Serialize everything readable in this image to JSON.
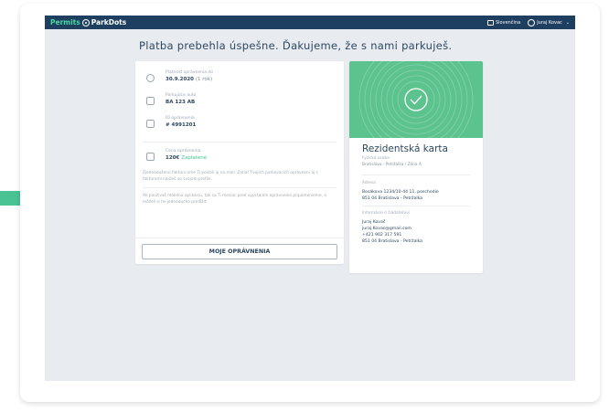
{
  "colors": {
    "accent": "#49c394",
    "topbar": "#1f3f60",
    "card_header": "#5cc28e",
    "arrow": "#49c394"
  },
  "topbar": {
    "brand_permits": "Permits",
    "brand_parkdots": "ParkDots",
    "language": "Slovenčina",
    "user": "Juraj Kovac"
  },
  "headline": "Platba prebehla úspešne. Ďakujeme, že s nami parkuješ.",
  "permit": {
    "validity_label": "Platnosť oprávnenia do",
    "validity_value": "30.9.2020",
    "validity_extra": "(1 rok)",
    "car_label": "Parkujúce auto",
    "car_value": "BA 123 AB",
    "id_label": "ID oprávnenia",
    "id_value": "# 4991201",
    "price_label": "Cena oprávnenia",
    "price_value": "120€",
    "price_status": "Zaplatené",
    "note_invoice": "Zjednodušenú faktúru sme Ti poslali aj na mail. Zatiaľ Tvojich parkovacích oprávnení aj s faktúrami nájdeš vo svojom profile.",
    "note_reminder": "Ak používaš mobilnú aplikáciu, tak sa Ti mesiac pred vypršaním oprávnenia pripomenieme, a môžeš si ho jednoducho predĺžiť.",
    "button": "MOJE OPRÁVNENIA"
  },
  "card": {
    "title": "Rezidentská karta",
    "zone_label": "Fyzická osoba",
    "zone_value": "Bratislava - Petržalka / Zóna A",
    "address_label": "Adresa",
    "address_line1": "Bosákova 1234/10-44 11. poschodie",
    "address_line2": "851 04 Bratislava - Petržalka",
    "applicant_label": "Informácie o žiadateľovi",
    "applicant_name": "Juraj Kovač",
    "applicant_email": "juraj.Kovac@gmail.com",
    "applicant_phone": "+421 902 317 591",
    "applicant_city": "851 04 Bratislava - Petržalka"
  },
  "icons": [
    "arrow-right-icon",
    "parkdots-logo-icon",
    "language-icon",
    "user-icon",
    "chevron-down-icon",
    "clock-icon",
    "car-icon",
    "id-card-icon",
    "price-tag-icon",
    "check-circle-icon"
  ]
}
